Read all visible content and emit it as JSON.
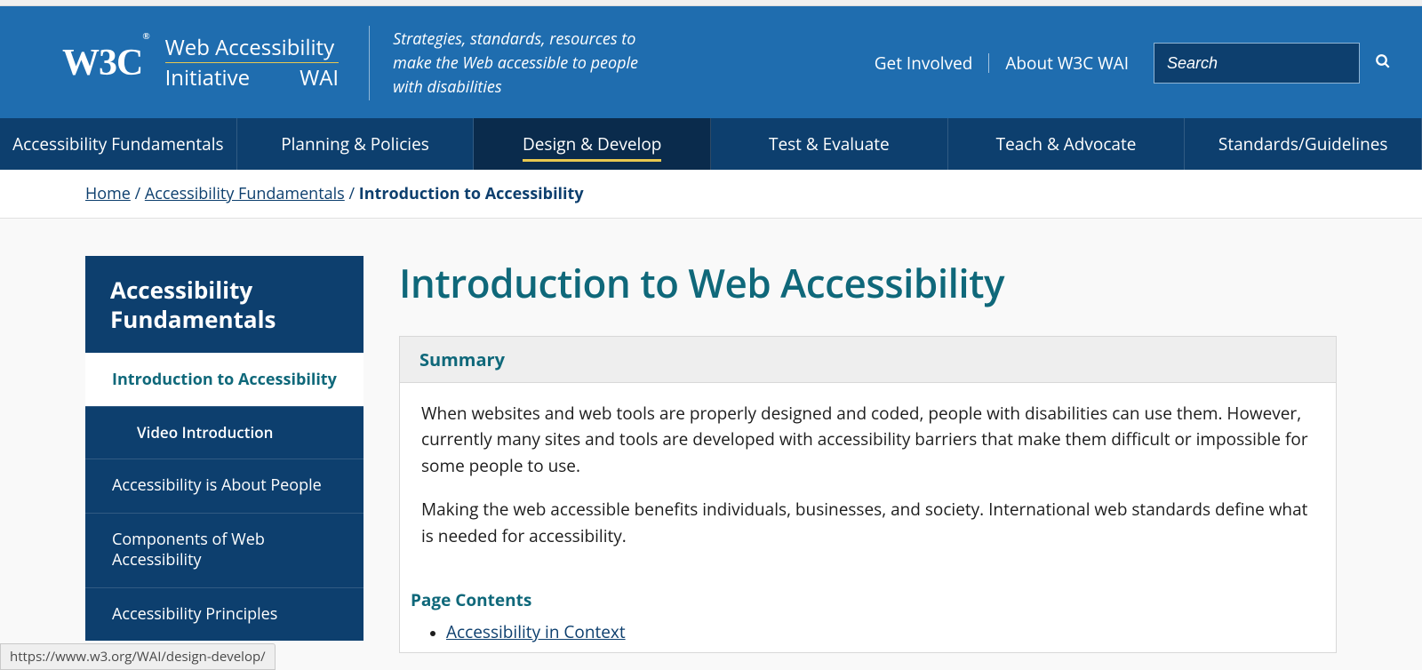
{
  "header": {
    "logo_w3c": "W3C",
    "logo_reg": "®",
    "wai_line1": "Web Accessibility",
    "wai_line2a": "Initiative",
    "wai_line2b": "WAI",
    "tagline": "Strategies, standards, resources to make the Web accessible to people with disabilities",
    "links": {
      "get_involved": "Get Involved",
      "about": "About W3C WAI"
    },
    "search_placeholder": "Search"
  },
  "mainnav": {
    "items": [
      "Accessibility Fundamentals",
      "Planning & Policies",
      "Design & Develop",
      "Test & Evaluate",
      "Teach & Advocate",
      "Standards/Guidelines"
    ],
    "active_index": 2
  },
  "breadcrumb": {
    "home": "Home",
    "parent": "Accessibility Fundamentals",
    "current": "Introduction to Accessibility"
  },
  "sidenav": {
    "header": "Accessibility Fundamentals",
    "items": [
      {
        "label": "Introduction to Accessibility",
        "current": true,
        "sub": false
      },
      {
        "label": "Video Introduction",
        "current": false,
        "sub": true
      },
      {
        "label": "Accessibility is About People",
        "current": false,
        "sub": false
      },
      {
        "label": "Components of Web Accessibility",
        "current": false,
        "sub": false
      },
      {
        "label": "Accessibility Principles",
        "current": false,
        "sub": false
      }
    ]
  },
  "page": {
    "title": "Introduction to Web Accessibility",
    "summary_label": "Summary",
    "summary_p1": "When websites and web tools are properly designed and coded, people with disabilities can use them. However, currently many sites and tools are developed with accessibility barriers that make them difficult or impossible for some people to use.",
    "summary_p2": "Making the web accessible benefits individuals, businesses, and society. International web standards define what is needed for accessibility.",
    "page_contents_label": "Page Contents",
    "contents": [
      "Accessibility in Context"
    ]
  },
  "status_url": "https://www.w3.org/WAI/design-develop/"
}
